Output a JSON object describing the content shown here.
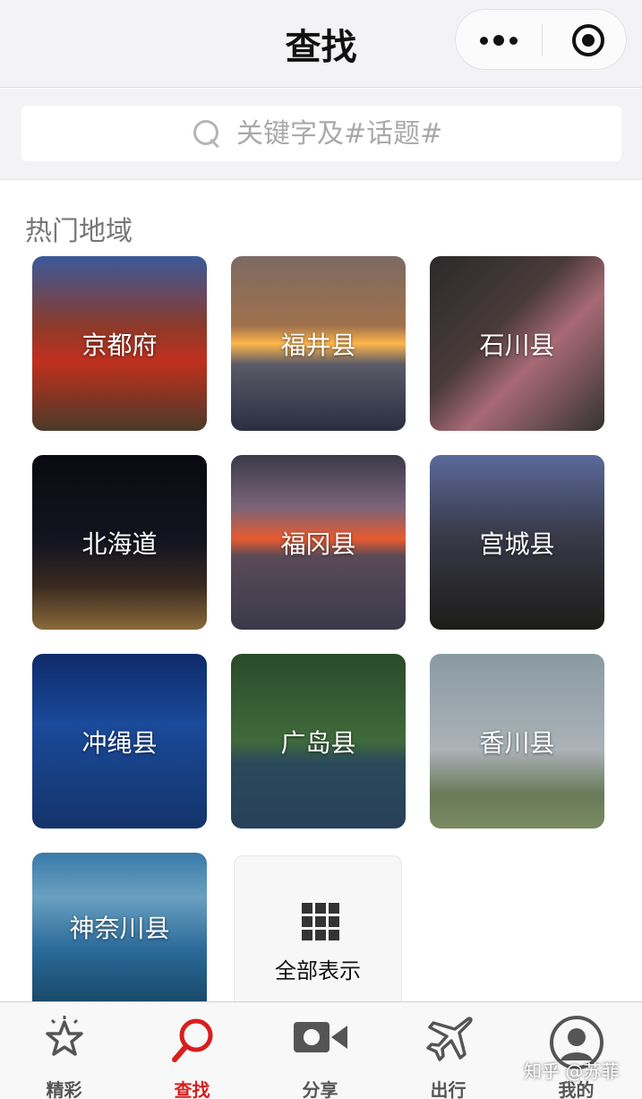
{
  "header": {
    "title": "查找"
  },
  "search": {
    "placeholder": "关键字及#话题#"
  },
  "section": {
    "title": "热门地域"
  },
  "regions": [
    {
      "name": "京都府"
    },
    {
      "name": "福井县"
    },
    {
      "name": "石川县"
    },
    {
      "name": "北海道"
    },
    {
      "name": "福冈县"
    },
    {
      "name": "宫城县"
    },
    {
      "name": "冲绳县"
    },
    {
      "name": "广岛县"
    },
    {
      "name": "香川县"
    },
    {
      "name": "神奈川县"
    }
  ],
  "show_all": {
    "label": "全部表示",
    "icon": "grid-icon"
  },
  "tabbar": {
    "items": [
      {
        "label": "精彩",
        "icon": "star-icon"
      },
      {
        "label": "查找",
        "icon": "search-icon"
      },
      {
        "label": "分享",
        "icon": "video-camera-icon"
      },
      {
        "label": "出行",
        "icon": "airplane-icon"
      },
      {
        "label": "我的",
        "icon": "user-icon"
      }
    ],
    "active_index": 1
  },
  "watermark": "知乎 @苏菲",
  "colors": {
    "accent": "#d81e1e",
    "background": "#f3f3f5"
  }
}
